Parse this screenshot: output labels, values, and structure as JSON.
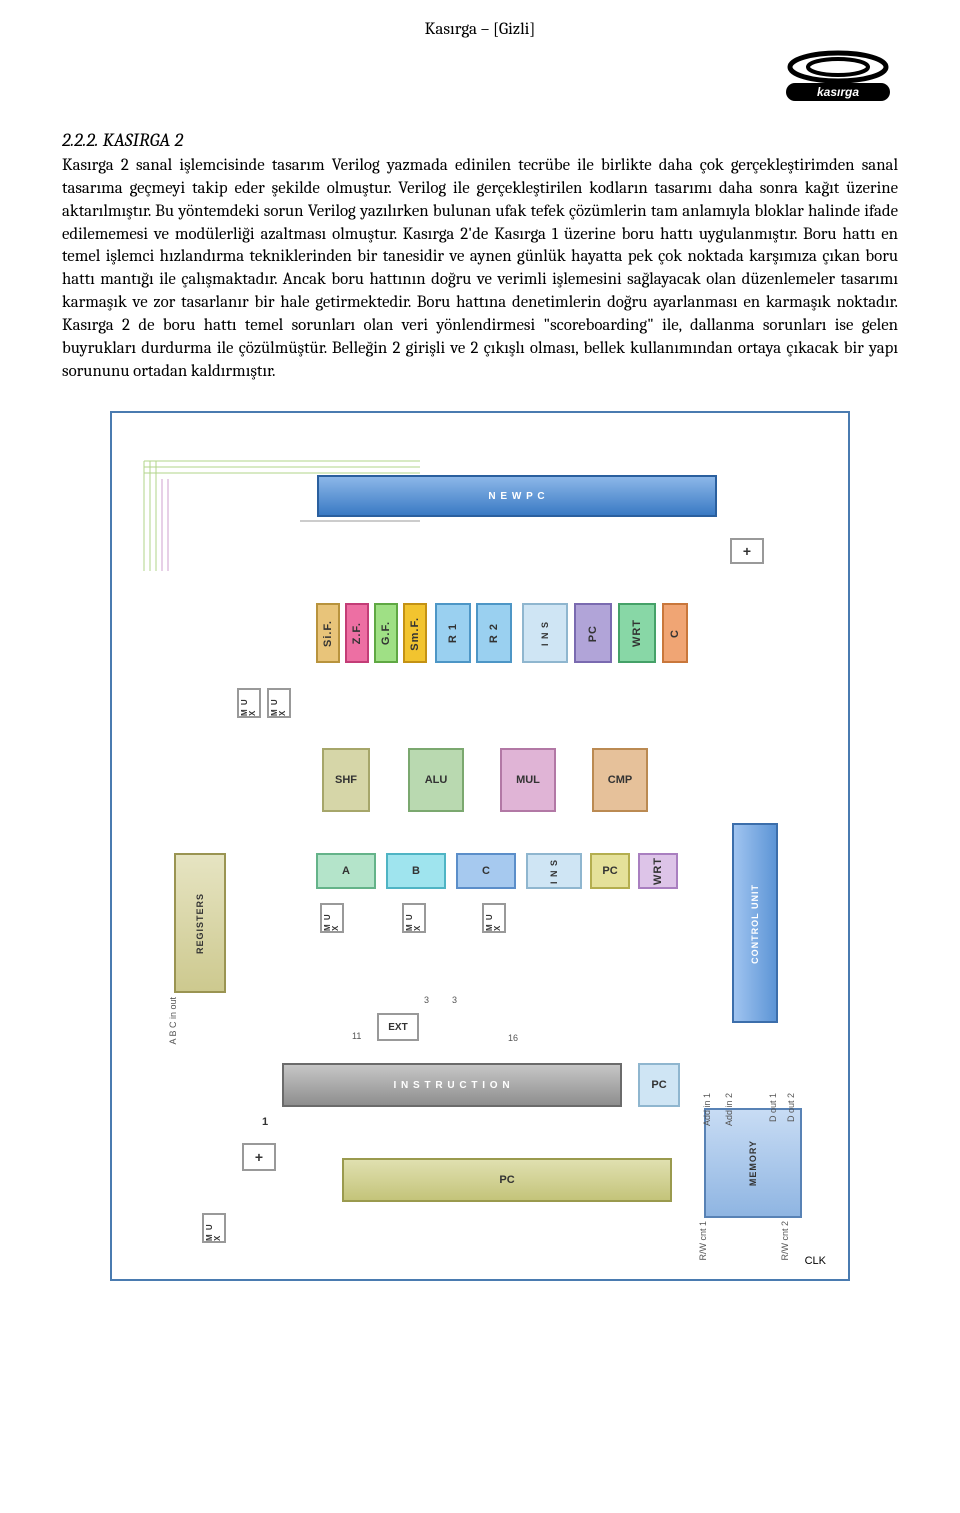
{
  "header": {
    "title": "Kasırga – [Gizli]"
  },
  "logo": {
    "brand": "kasırga"
  },
  "section": {
    "number": "2.2.2.",
    "title": "KASIRGA 2",
    "body": "Kasırga 2 sanal işlemcisinde tasarım Verilog yazmada edinilen tecrübe ile birlikte daha çok gerçekleştirimden sanal tasarıma geçmeyi takip eder şekilde olmuştur. Verilog ile gerçekleştirilen kodların tasarımı daha sonra kağıt üzerine aktarılmıştır. Bu yöntemdeki sorun Verilog yazılırken bulunan ufak tefek çözümlerin tam anlamıyla bloklar halinde ifade edilememesi ve modülerliği azaltması olmuştur. Kasırga 2'de Kasırga 1 üzerine boru hattı uygulanmıştır. Boru hattı en temel işlemci hızlandırma tekniklerinden bir tanesidir ve aynen günlük hayatta pek çok noktada karşımıza çıkan boru hattı mantığı ile çalışmaktadır. Ancak boru hattının doğru ve verimli işlemesini sağlayacak olan düzenlemeler tasarımı karmaşık ve zor tasarlanır bir hale getirmektedir. Boru hattına denetimlerin doğru ayarlanması en karmaşık noktadır. Kasırga 2 de boru hattı temel sorunları olan veri yönlendirmesi \"scoreboarding\" ile, dallanma sorunları ise gelen buyrukları durdurma ile çözülmüştür. Belleğin 2 girişli ve 2 çıkışlı olması, bellek kullanımından ortaya çıkacak bir yapı sorununu ortadan kaldırmıştır."
  },
  "diagram": {
    "newpc": "N E W  P C",
    "plus": "+",
    "sif": "Si.F.",
    "zf": "Z.F.",
    "gf": "G.F.",
    "smf": "Sm.F.",
    "r1": "R 1",
    "r2": "R 2",
    "ins": "I N S",
    "pc": "PC",
    "wrt": "WRT",
    "c": "C",
    "mux": "M U X",
    "shf": "SHF",
    "alu": "ALU",
    "mul": "MUL",
    "cmp": "CMP",
    "a": "A",
    "b": "B",
    "registers": "REGISTERS",
    "ext": "EXT",
    "instruction": "I N S T R U C T I O N",
    "ctrl": "CONTROL UNIT",
    "memory": "MEMORY",
    "clk": "CLK",
    "one": "1",
    "three": "3",
    "eleven": "11",
    "sixteen": "16",
    "addin1": "Add in 1",
    "addin2": "Add in 2",
    "dout1": "D out 1",
    "dout2": "D out 2",
    "rwcnt1": "R/W cnt 1",
    "rwcnt2": "R/W cnt 2",
    "abcio": "A B C in out"
  }
}
